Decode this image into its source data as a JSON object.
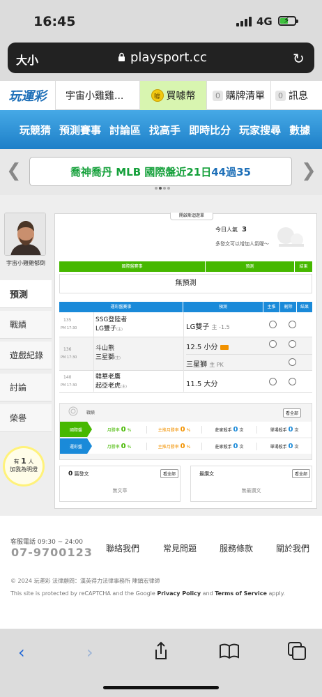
{
  "status": {
    "time": "16:45",
    "network": "4G"
  },
  "browser": {
    "text_size_label": "大小",
    "url": "playsport.cc"
  },
  "header": {
    "logo": "玩運彩",
    "username": "宇宙小雞雞...",
    "buy_label": "買噱幣",
    "buy_coin": "噱",
    "cart_count": "0",
    "cart_label": "購牌清單",
    "msg_count": "0",
    "msg_label": "訊息"
  },
  "nav": {
    "items": [
      "玩競猜",
      "預測賽事",
      "討論區",
      "找高手",
      "即時比分",
      "玩家搜尋",
      "數據"
    ]
  },
  "banner": {
    "prefix": "喬神喬丹 MLB 國際盤近21日",
    "record": "44過35"
  },
  "profile": {
    "name": "宇宙小雞雞郁倒",
    "sidebar": [
      "預測",
      "戰績",
      "遊戲紀錄",
      "討論",
      "榮譽"
    ],
    "helpers_count": "1",
    "helpers_pre": "有",
    "helpers_post": "人",
    "helpers_line2": "加我為明燈"
  },
  "panel": {
    "open_tab": "開啟斯迴遊單",
    "today_pop_label": "今日人氣",
    "today_pop_value": "3",
    "more_post": "多發文可以增加人氣喔～",
    "intl_headers": [
      "國際盤賽事",
      "預測",
      "結果"
    ],
    "no_prediction": "無預測",
    "sport_headers": [
      "運彩盤賽事",
      "預測",
      "主推",
      "刪除",
      "結果"
    ],
    "games": [
      {
        "num": "135",
        "time": "PM 17:30",
        "away": "SSG登陸者",
        "home": "LG雙子",
        "home_tag": "(主)",
        "picks": [
          {
            "team": "LG雙子",
            "note": "主 -1.5"
          }
        ]
      },
      {
        "num": "136",
        "time": "PM 17:30",
        "away": "斗山熊",
        "home": "三星獅",
        "home_tag": "(主)",
        "picks": [
          {
            "team": "12.5 小分",
            "note": ""
          },
          {
            "team": "三星獅",
            "note": "主 PK"
          }
        ]
      },
      {
        "num": "140",
        "time": "PM 17:30",
        "away": "韓華老鷹",
        "home": "起亞老虎",
        "home_tag": "(主)",
        "picks": [
          {
            "team": "11.5 大分",
            "note": ""
          }
        ]
      }
    ],
    "records": {
      "label": "戰績",
      "view_all": "看全部",
      "rows": [
        {
          "tag": "國際盤",
          "cells": [
            {
              "label": "月勝率",
              "value": "0",
              "unit": "%"
            },
            {
              "label": "主推月勝率",
              "value": "0",
              "unit": "%"
            },
            {
              "label": "莊家殺手",
              "value": "0",
              "unit": "次"
            },
            {
              "label": "單場殺手",
              "value": "0",
              "unit": "次"
            }
          ]
        },
        {
          "tag": "運彩盤",
          "cells": [
            {
              "label": "月勝率",
              "value": "0",
              "unit": "%"
            },
            {
              "label": "主推月勝率",
              "value": "0",
              "unit": "%"
            },
            {
              "label": "莊家殺手",
              "value": "0",
              "unit": "次"
            },
            {
              "label": "單場殺手",
              "value": "0",
              "unit": "次"
            }
          ]
        }
      ]
    },
    "posts": {
      "count": "0",
      "title": "篇發文",
      "view_all": "看全部",
      "empty": "無文章"
    },
    "replies": {
      "title": "最讚文",
      "view_all": "看全部",
      "empty": "無最讚文"
    }
  },
  "footer": {
    "service_label": "客服電話 09:30 ~ 24:00",
    "phone": "07-9700123",
    "links": [
      "聯絡我們",
      "常見問題",
      "服務條款",
      "關於我們"
    ],
    "copyright": "© 2024 玩運彩 法律顧問：漢英得力法律事務所 陳鎮宏律師",
    "recaptcha_pre": "This site is protected by reCAPTCHA and the Google",
    "privacy": "Privacy Policy",
    "and": "and",
    "terms": "Terms of Service",
    "apply": "apply."
  },
  "colors": {
    "accent_blue": "#1d7fc8",
    "green": "#46b800",
    "orange": "#f29200"
  }
}
